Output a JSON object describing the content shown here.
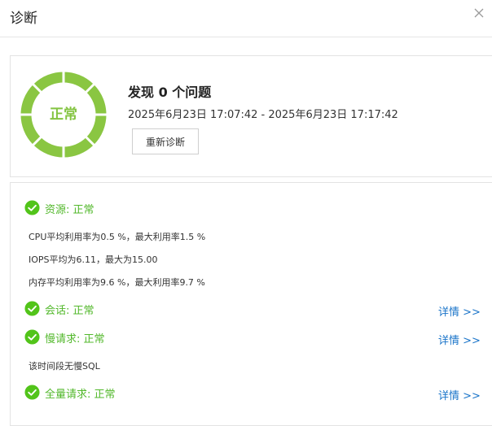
{
  "dialog": {
    "title": "诊断",
    "close_icon": "close-icon"
  },
  "summary": {
    "status": "正常",
    "found_text": "发现 0 个问题",
    "time_range": "2025年6月23日 17:07:42 - 2025年6月23日 17:17:42",
    "rediagnose_label": "重新诊断",
    "ring_color": "#8ac642"
  },
  "sections": {
    "resource": {
      "title": "资源: 正常",
      "metrics": [
        "CPU平均利用率为0.5 %，最大利用率1.5 %",
        "IOPS平均为6.11，最大为15.00",
        "内存平均利用率为9.6 %，最大利用率9.7 %"
      ]
    },
    "session": {
      "title": "会话: 正常",
      "link": "详情 >>"
    },
    "slow_query": {
      "title": "慢请求: 正常",
      "link": "详情 >>",
      "note": "该时间段无慢SQL"
    },
    "full_query": {
      "title": "全量请求: 正常",
      "link": "详情 >>"
    }
  },
  "colors": {
    "ok_green": "#52c41a",
    "link_blue": "#1a74c9"
  }
}
